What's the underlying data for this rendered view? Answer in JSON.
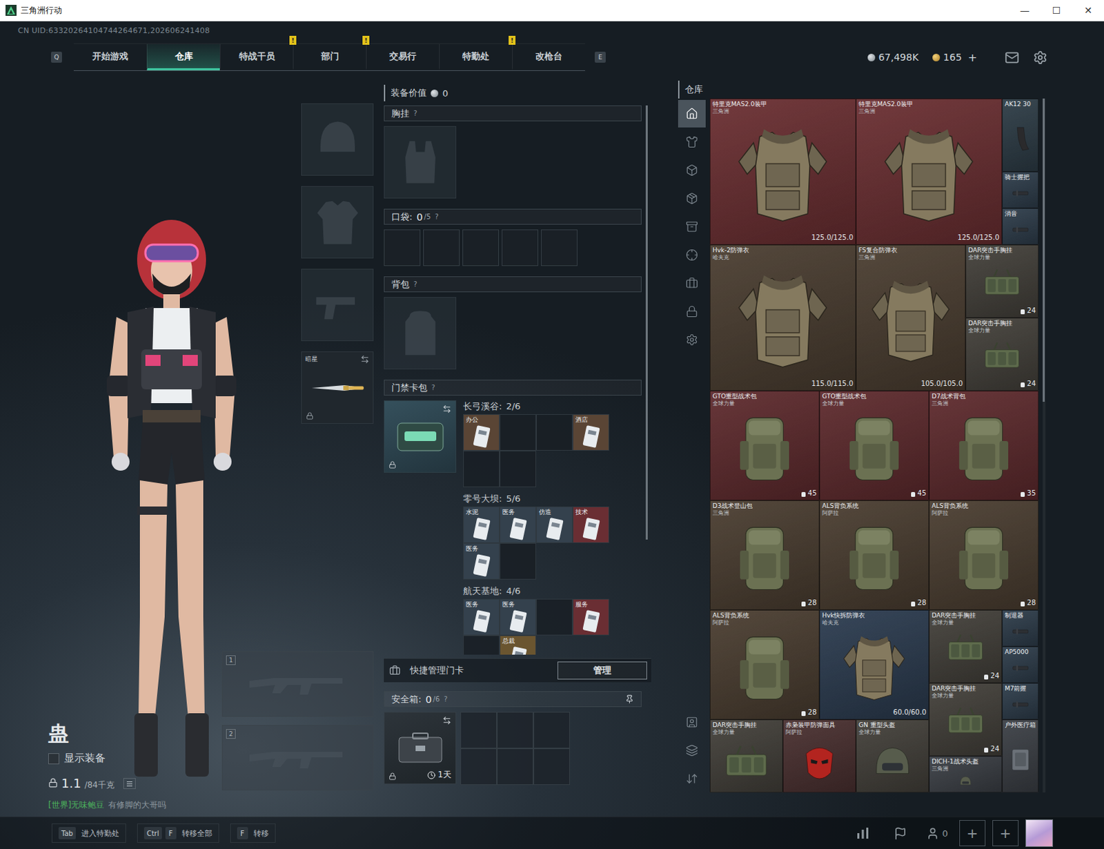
{
  "window": {
    "title": "三角洲行动",
    "controls": [
      "—",
      "☐",
      "✕"
    ]
  },
  "uid": "CN UID:63320264104744264671,202606241408",
  "nav": {
    "left_key": "Q",
    "right_key": "E",
    "alert_mark": "!",
    "tabs": [
      {
        "label": "开始游戏",
        "selected": false,
        "alert": false
      },
      {
        "label": "仓库",
        "selected": true,
        "alert": false
      },
      {
        "label": "特战干员",
        "selected": false,
        "alert": true
      },
      {
        "label": "部门",
        "selected": false,
        "alert": true
      },
      {
        "label": "交易行",
        "selected": false,
        "alert": false
      },
      {
        "label": "特勤处",
        "selected": false,
        "alert": true
      },
      {
        "label": "改枪台",
        "selected": false,
        "alert": false
      }
    ]
  },
  "currency": {
    "silver": "67,498K",
    "coins": "165",
    "add": "+"
  },
  "character": {
    "name": "蛊",
    "show_equipment": {
      "label": "显示装备",
      "checked": false
    },
    "weight": "1.1",
    "weight_max": "/84千克",
    "chat": {
      "channel": "[世界]",
      "sender": "无味鲍豆",
      "message": "有修脚的大哥吗"
    }
  },
  "equip_slots": [
    {
      "kind": "helmet",
      "filled": false,
      "label": "",
      "locked": false
    },
    {
      "kind": "armor",
      "filled": false,
      "label": "",
      "locked": false
    },
    {
      "kind": "pistol",
      "filled": false,
      "label": "",
      "locked": false
    },
    {
      "kind": "melee",
      "filled": true,
      "label": "暗星",
      "locked": true
    }
  ],
  "weapon_slots": [
    {
      "number": "1"
    },
    {
      "number": "2"
    }
  ],
  "loadout": {
    "value_label": "装备价值",
    "value": "0",
    "chest": {
      "title": "胸挂",
      "help": "?",
      "filled": false
    },
    "pockets": {
      "title": "口袋:",
      "count": "0",
      "capacity": "/5",
      "help": "?",
      "slots": [
        {
          "filled": false
        },
        {
          "filled": false
        },
        {
          "filled": false
        },
        {
          "filled": false
        },
        {
          "filled": false
        }
      ]
    },
    "backpack": {
      "title": "背包",
      "help": "?",
      "filled": false
    },
    "keycards": {
      "title": "门禁卡包",
      "help": "?",
      "locked": true,
      "maps": [
        {
          "name": "长弓溪谷:",
          "count": "2/6",
          "slots": [
            {
              "filled": true,
              "label": "办公",
              "color": "#5a4535"
            },
            {
              "filled": false,
              "label": "",
              "color": ""
            },
            {
              "filled": false,
              "label": "",
              "color": ""
            },
            {
              "filled": true,
              "label": "酒店",
              "color": "#5a4535"
            },
            {
              "filled": false,
              "label": "",
              "color": ""
            },
            {
              "filled": false,
              "label": "",
              "color": ""
            }
          ]
        },
        {
          "name": "零号大坝:",
          "count": "5/6",
          "slots": [
            {
              "filled": true,
              "label": "水泥",
              "color": "#34414d"
            },
            {
              "filled": true,
              "label": "医务",
              "color": "#34414d"
            },
            {
              "filled": true,
              "label": "仿造",
              "color": "#34414d"
            },
            {
              "filled": true,
              "label": "技术",
              "color": "#6a2e33"
            },
            {
              "filled": true,
              "label": "医务",
              "color": "#34414d"
            },
            {
              "filled": false,
              "label": "",
              "color": ""
            }
          ]
        },
        {
          "name": "航天基地:",
          "count": "4/6",
          "slots": [
            {
              "filled": true,
              "label": "医务",
              "color": "#34414d"
            },
            {
              "filled": true,
              "label": "医务",
              "color": "#34414d"
            },
            {
              "filled": false,
              "label": "",
              "color": ""
            },
            {
              "filled": true,
              "label": "服务",
              "color": "#6a2e33"
            },
            {
              "filled": false,
              "label": "",
              "color": ""
            },
            {
              "filled": true,
              "label": "总裁",
              "color": "#6a5530"
            }
          ]
        }
      ]
    },
    "quick_manage": {
      "label": "快捷管理门卡",
      "button": "管理"
    },
    "safe": {
      "title": "安全箱:",
      "count": "0",
      "capacity": "/6",
      "help": "?",
      "timer": "1天",
      "locked": true,
      "slots": [
        {
          "filled": false
        },
        {
          "filled": false
        },
        {
          "filled": false
        },
        {
          "filled": false
        },
        {
          "filled": false
        },
        {
          "filled": false
        }
      ]
    }
  },
  "warehouse": {
    "title": "仓库",
    "sidebar": {
      "top": [
        {
          "selected": true
        },
        {
          "selected": false
        },
        {
          "selected": false
        },
        {
          "selected": false
        },
        {
          "selected": false
        },
        {
          "selected": false
        },
        {
          "selected": false
        },
        {
          "selected": false
        },
        {
          "selected": false
        }
      ],
      "bottom": [
        {
          "selected": false
        },
        {
          "selected": false
        },
        {
          "selected": false
        }
      ]
    },
    "items": [
      {
        "name": "特里克MAS2.0装甲",
        "maker": "三角洲",
        "kind": "armor",
        "reading": "125.0/125.0",
        "color": "#6a2e31"
      },
      {
        "name": "特里克MAS2.0装甲",
        "maker": "三角洲",
        "kind": "armor",
        "reading": "125.0/125.0",
        "color": "#6a2e31"
      },
      {
        "name": "AK12 30",
        "maker": "",
        "kind": "mag",
        "reading": "",
        "color": "#2d3c46"
      },
      {
        "name": "骑士握把",
        "maker": "",
        "kind": "attachment",
        "reading": "",
        "color": "#2e3d4b"
      },
      {
        "name": "消音",
        "maker": "",
        "kind": "attachment",
        "reading": "",
        "color": "#2e3d4b"
      },
      {
        "name": "Hvk-2防弹衣",
        "maker": "哈夫克",
        "kind": "armor",
        "reading": "115.0/115.0",
        "color": "#4a3d30"
      },
      {
        "name": "FS复合防弹衣",
        "maker": "三角洲",
        "kind": "armor",
        "reading": "105.0/105.0",
        "color": "#4a3d30"
      },
      {
        "name": "DAR突击手胸挂",
        "maker": "全球力量",
        "kind": "rig",
        "reading": "24",
        "color": "#43403a"
      },
      {
        "name": "DAR突击手胸挂",
        "maker": "全球力量",
        "kind": "rig",
        "reading": "24",
        "color": "#43403a"
      },
      {
        "name": "GTO重型战术包",
        "maker": "全球力量",
        "kind": "backpack",
        "reading": "45",
        "color": "#5e2a2d"
      },
      {
        "name": "GTO重型战术包",
        "maker": "全球力量",
        "kind": "backpack",
        "reading": "45",
        "color": "#5e2a2d"
      },
      {
        "name": "D7战术背包",
        "maker": "三角洲",
        "kind": "backpack",
        "reading": "35",
        "color": "#5e2a2d"
      },
      {
        "name": "D3战术登山包",
        "maker": "三角洲",
        "kind": "backpack",
        "reading": "28",
        "color": "#4a3d30"
      },
      {
        "name": "ALS背负系统",
        "maker": "阿萨拉",
        "kind": "backpack",
        "reading": "28",
        "color": "#4a3d30"
      },
      {
        "name": "ALS背负系统",
        "maker": "阿萨拉",
        "kind": "backpack",
        "reading": "28",
        "color": "#4a3d30"
      },
      {
        "name": "ALS背负系统",
        "maker": "阿萨拉",
        "kind": "backpack",
        "reading": "28",
        "color": "#4a3d30"
      },
      {
        "name": "Hvk快拆防弹衣",
        "maker": "哈夫克",
        "kind": "armor",
        "reading": "60.0/60.0",
        "color": "#2b3b4f"
      },
      {
        "name": "DAR突击手胸挂",
        "maker": "全球力量",
        "kind": "rig",
        "reading": "24",
        "color": "#43403a"
      },
      {
        "name": "制退器",
        "maker": "",
        "kind": "attachment",
        "reading": "",
        "color": "#2e3d4b"
      },
      {
        "name": "AP5000",
        "maker": "",
        "kind": "attachment",
        "reading": "",
        "color": "#2e3d4b"
      },
      {
        "name": "DAR突击手胸挂",
        "maker": "全球力量",
        "kind": "rig",
        "reading": "24",
        "color": "#43403a"
      },
      {
        "name": "M7前握",
        "maker": "",
        "kind": "attachment",
        "reading": "",
        "color": "#2e3d4b"
      },
      {
        "name": "DAR突击手胸挂",
        "maker": "全球力量",
        "kind": "rig",
        "reading": "",
        "color": "#43403a"
      },
      {
        "name": "赤枭装甲防弹面具",
        "maker": "阿萨拉",
        "kind": "mask",
        "reading": "",
        "color": "#4a3030"
      },
      {
        "name": "GN 重型头盔",
        "maker": "全球力量",
        "kind": "helmet",
        "reading": "",
        "color": "#43403a"
      },
      {
        "name": "户外医疗箱",
        "maker": "",
        "kind": "medkit",
        "reading": "",
        "color": "#3b3f45"
      },
      {
        "name": "DICH-1战术头盔",
        "maker": "三角洲",
        "kind": "helmet",
        "reading": "",
        "color": "#3b3f45"
      }
    ]
  },
  "hints": [
    {
      "keys": [
        "Tab"
      ],
      "label": "进入特勤处"
    },
    {
      "keys": [
        "Ctrl",
        "F"
      ],
      "label": "转移全部"
    },
    {
      "keys": [
        "F"
      ],
      "label": "转移"
    }
  ],
  "social": {
    "squad_count": "0",
    "add_slots": [
      "+",
      "+"
    ]
  }
}
